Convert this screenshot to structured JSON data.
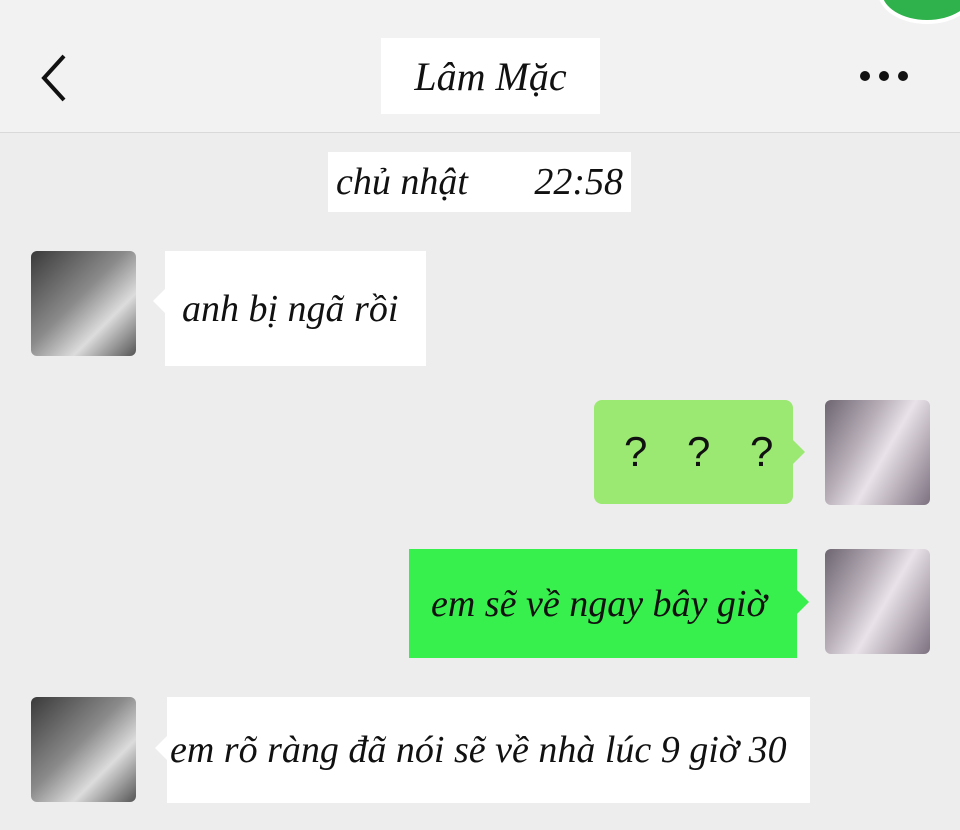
{
  "header": {
    "title": "Lâm Mặc",
    "back_icon": "chevron-left-icon",
    "more_icon": "ellipsis-icon"
  },
  "timebar": {
    "day": "chủ nhật",
    "time": "22:58"
  },
  "messages": [
    {
      "side": "left",
      "text": "anh bị ngã rồi"
    },
    {
      "side": "right",
      "text": "? ? ?"
    },
    {
      "side": "right",
      "text": "em sẽ về ngay bây giờ"
    },
    {
      "side": "left",
      "text": "em rõ ràng đã nói sẽ về nhà lúc 9 giờ 30"
    }
  ],
  "colors": {
    "background": "#ededed",
    "bubble_white": "#ffffff",
    "bubble_green_light": "#9be872",
    "bubble_green_bright": "#38f04d"
  }
}
